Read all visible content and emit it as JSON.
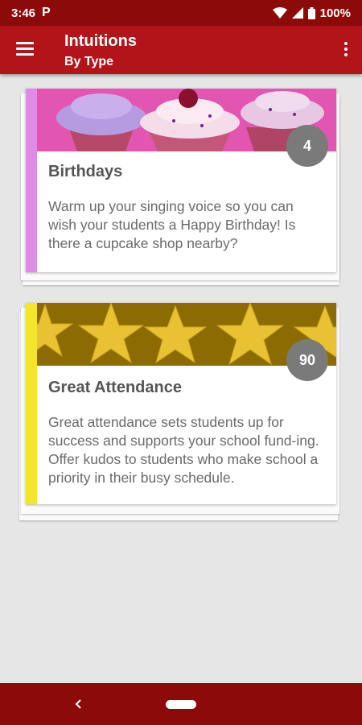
{
  "status_bar": {
    "time": "3:46",
    "notification_icon": "P",
    "battery": "100%",
    "icons": [
      "wifi-icon",
      "signal-icon",
      "battery-icon"
    ]
  },
  "app_bar": {
    "title": "Intuitions",
    "subtitle": "By Type",
    "icons": [
      "menu-icon",
      "more-vert-icon"
    ]
  },
  "cards": [
    {
      "title": "Birthdays",
      "count": "4",
      "description": "Warm up your singing voice so you can wish your students a Happy Birthday! Is there a cupcake shop nearby?",
      "accent_color": "#e08be8",
      "banner": "cupcakes-image"
    },
    {
      "title": "Great Attendance",
      "count": "90",
      "description": "Great attendance sets students up for success and supports your school fund-ing. Offer kudos to students who make school a priority in their busy schedule.",
      "accent_color": "#f5e52a",
      "banner": "gold-stars-image"
    }
  ],
  "nav_bar": {
    "icons": [
      "back-icon",
      "home-pill-icon"
    ]
  },
  "colors": {
    "status_bar": "#8c0a0a",
    "app_bar": "#b3141a",
    "background": "#e6e6e6",
    "badge": "#7a7a7a"
  }
}
